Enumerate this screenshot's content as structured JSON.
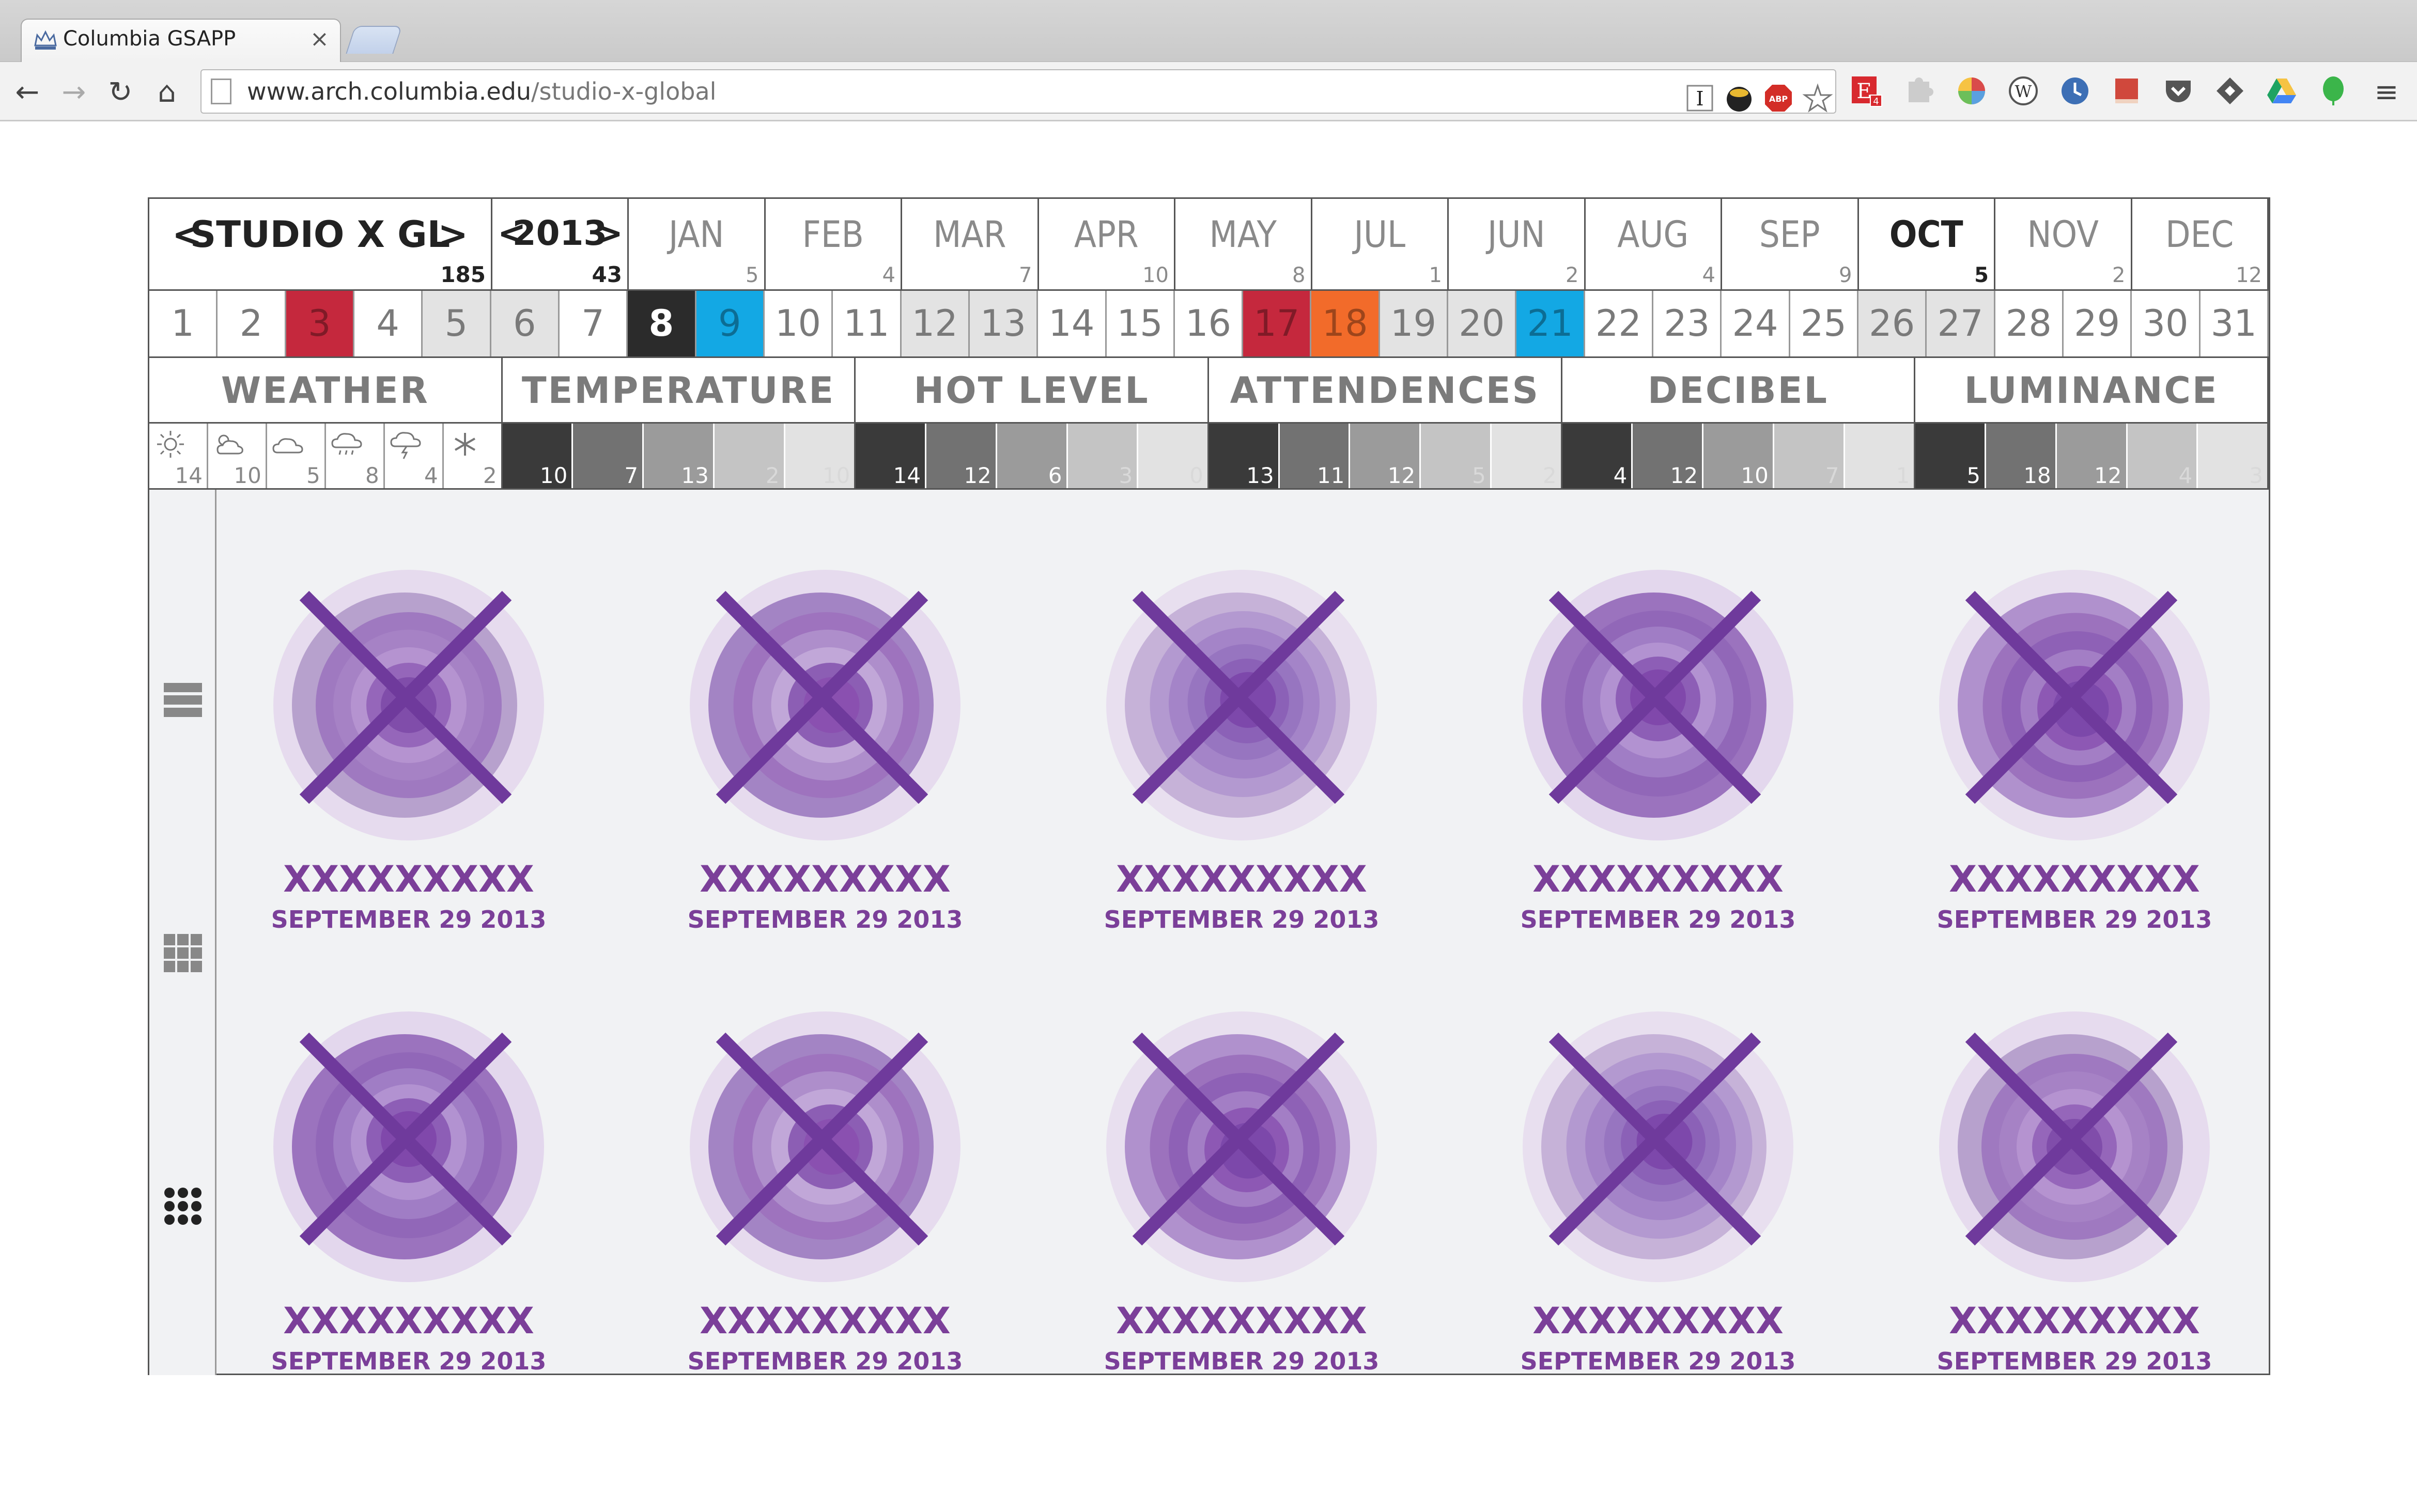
{
  "browser": {
    "tab_title": "Columbia GSAPP",
    "tab_close": "×",
    "url_host": "www.arch.columbia.edu",
    "url_path": "/studio-x-global",
    "nav": {
      "back": "←",
      "forward": "→",
      "reload": "↻",
      "home": "⌂"
    },
    "menu": "≡",
    "extensions": [
      "instapaper-icon",
      "spy-icon",
      "adblock-icon",
      "bookmark-star-icon",
      "evernote-icon",
      "puzzle-icon",
      "color-wheel-icon",
      "wikipedia-icon",
      "clock-icon",
      "red-book-icon",
      "pocket-icon",
      "feedly-icon",
      "google-drive-icon",
      "green-leaf-icon"
    ],
    "ext_badges": {
      "adblock": "ABP",
      "evernote": "E",
      "evernote_count": "4",
      "wikipedia": "W",
      "instapaper": "I"
    }
  },
  "header": {
    "studio_prev": "<",
    "studio_name": "STUDIO X GL",
    "studio_next": ">",
    "studio_count": "185",
    "year_prev": "<",
    "year": "2013",
    "year_next": ">",
    "year_count": "43"
  },
  "months": [
    {
      "name": "JAN",
      "count": "5",
      "active": false
    },
    {
      "name": "FEB",
      "count": "4",
      "active": false
    },
    {
      "name": "MAR",
      "count": "7",
      "active": false
    },
    {
      "name": "APR",
      "count": "10",
      "active": false
    },
    {
      "name": "MAY",
      "count": "8",
      "active": false
    },
    {
      "name": "JUL",
      "count": "1",
      "active": false
    },
    {
      "name": "JUN",
      "count": "2",
      "active": false
    },
    {
      "name": "AUG",
      "count": "4",
      "active": false
    },
    {
      "name": "SEP",
      "count": "9",
      "active": false
    },
    {
      "name": "OCT",
      "count": "5",
      "active": true
    },
    {
      "name": "NOV",
      "count": "2",
      "active": false
    },
    {
      "name": "DEC",
      "count": "12",
      "active": false
    }
  ],
  "days": [
    {
      "n": "1",
      "state": "plain"
    },
    {
      "n": "2",
      "state": "plain"
    },
    {
      "n": "3",
      "state": "red"
    },
    {
      "n": "4",
      "state": "plain"
    },
    {
      "n": "5",
      "state": "grey"
    },
    {
      "n": "6",
      "state": "grey"
    },
    {
      "n": "7",
      "state": "plain"
    },
    {
      "n": "8",
      "state": "black"
    },
    {
      "n": "9",
      "state": "blue"
    },
    {
      "n": "10",
      "state": "plain"
    },
    {
      "n": "11",
      "state": "plain"
    },
    {
      "n": "12",
      "state": "grey"
    },
    {
      "n": "13",
      "state": "grey"
    },
    {
      "n": "14",
      "state": "plain"
    },
    {
      "n": "15",
      "state": "plain"
    },
    {
      "n": "16",
      "state": "plain"
    },
    {
      "n": "17",
      "state": "red"
    },
    {
      "n": "18",
      "state": "orange"
    },
    {
      "n": "19",
      "state": "grey"
    },
    {
      "n": "20",
      "state": "grey"
    },
    {
      "n": "21",
      "state": "blue"
    },
    {
      "n": "22",
      "state": "plain"
    },
    {
      "n": "23",
      "state": "plain"
    },
    {
      "n": "24",
      "state": "plain"
    },
    {
      "n": "25",
      "state": "plain"
    },
    {
      "n": "26",
      "state": "grey"
    },
    {
      "n": "27",
      "state": "grey"
    },
    {
      "n": "28",
      "state": "plain"
    },
    {
      "n": "29",
      "state": "plain"
    },
    {
      "n": "30",
      "state": "plain"
    },
    {
      "n": "31",
      "state": "plain"
    }
  ],
  "categories": [
    "WEATHER",
    "TEMPERATURE",
    "HOT LEVEL",
    "ATTENDENCES",
    "DECIBEL",
    "LUMINANCE"
  ],
  "weather": [
    {
      "icon": "sun-icon",
      "count": "14"
    },
    {
      "icon": "partly-cloudy-icon",
      "count": "10"
    },
    {
      "icon": "cloud-icon",
      "count": "5"
    },
    {
      "icon": "rain-icon",
      "count": "8"
    },
    {
      "icon": "thunderstorm-icon",
      "count": "4"
    },
    {
      "icon": "snow-icon",
      "count": "2"
    }
  ],
  "levels": [
    {
      "name": "temperature",
      "values": [
        "10",
        "7",
        "13",
        "2",
        "10"
      ]
    },
    {
      "name": "hot-level",
      "values": [
        "14",
        "12",
        "6",
        "3",
        "0"
      ]
    },
    {
      "name": "attendences",
      "values": [
        "13",
        "11",
        "12",
        "5",
        "2"
      ]
    },
    {
      "name": "decibel",
      "values": [
        "4",
        "12",
        "10",
        "7",
        "1"
      ]
    },
    {
      "name": "luminance",
      "values": [
        "5",
        "18",
        "12",
        "4",
        "3"
      ]
    }
  ],
  "level_colors": [
    "#3a3a3a",
    "#727272",
    "#9b9b9b",
    "#c4c4c4",
    "#e2e2e2"
  ],
  "day_colors": {
    "red": "#c5283d",
    "blue": "#13a8e4",
    "orange": "#f26b2a",
    "black": "#2b2b2b",
    "grey": "#e3e3e3",
    "plain": "#ffffff"
  },
  "views": [
    "list-view-icon",
    "grid-view-icon",
    "dot-grid-view-icon"
  ],
  "events": [
    {
      "title": "XXXXXXXXX",
      "date": "SEPTEMBER 29 2013",
      "variant": 0
    },
    {
      "title": "XXXXXXXXX",
      "date": "SEPTEMBER 29 2013",
      "variant": 1
    },
    {
      "title": "XXXXXXXXX",
      "date": "SEPTEMBER 29 2013",
      "variant": 2
    },
    {
      "title": "XXXXXXXXX",
      "date": "SEPTEMBER 29 2013",
      "variant": 3
    },
    {
      "title": "XXXXXXXXX",
      "date": "SEPTEMBER 29 2013",
      "variant": 4
    },
    {
      "title": "XXXXXXXXX",
      "date": "SEPTEMBER 29 2013",
      "variant": 3
    },
    {
      "title": "XXXXXXXXX",
      "date": "SEPTEMBER 29 2013",
      "variant": 1
    },
    {
      "title": "XXXXXXXXX",
      "date": "SEPTEMBER 29 2013",
      "variant": 4
    },
    {
      "title": "XXXXXXXXX",
      "date": "SEPTEMBER 29 2013",
      "variant": 2
    },
    {
      "title": "XXXXXXXXX",
      "date": "SEPTEMBER 29 2013",
      "variant": 0
    }
  ],
  "accent": "#7b3f99"
}
